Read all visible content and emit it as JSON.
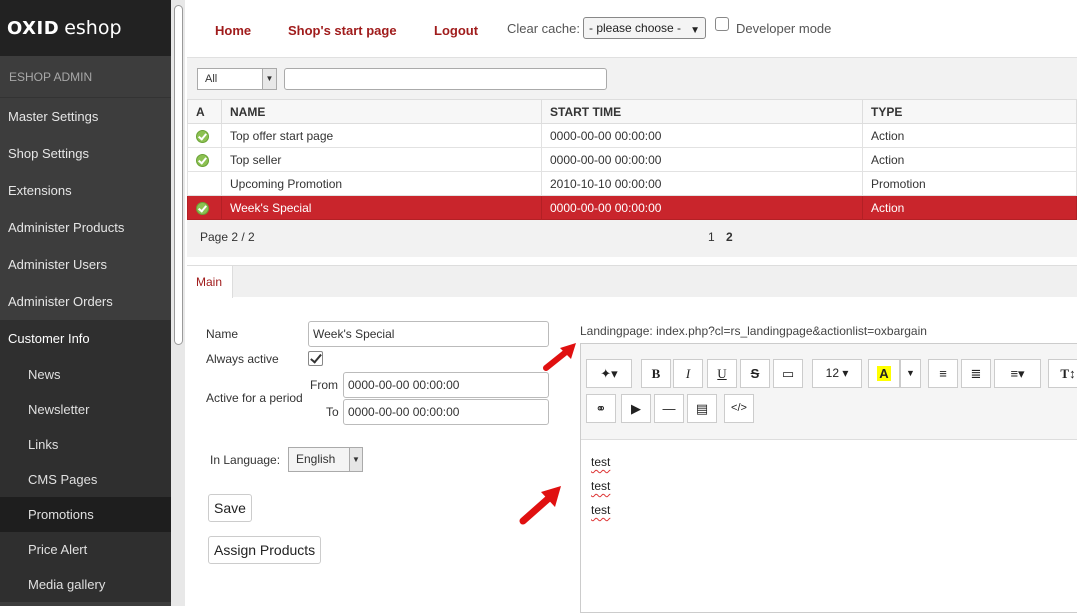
{
  "brand": {
    "logo_bold": "OXID",
    "logo_light": "eshop",
    "admin_label": "ESHOP ADMIN"
  },
  "sidebar": {
    "items": [
      {
        "label": "Master Settings"
      },
      {
        "label": "Shop Settings"
      },
      {
        "label": "Extensions"
      },
      {
        "label": "Administer Products"
      },
      {
        "label": "Administer Users"
      },
      {
        "label": "Administer Orders"
      },
      {
        "label": "Customer Info"
      }
    ],
    "subitems": [
      {
        "label": "News"
      },
      {
        "label": "Newsletter"
      },
      {
        "label": "Links"
      },
      {
        "label": "CMS Pages"
      },
      {
        "label": "Promotions"
      },
      {
        "label": "Price Alert"
      },
      {
        "label": "Media gallery"
      }
    ]
  },
  "topbar": {
    "home": "Home",
    "start_page": "Shop's start page",
    "logout": "Logout",
    "clear_cache_label": "Clear cache:",
    "clear_cache_value": "- please choose -",
    "developer_mode": "Developer mode"
  },
  "list": {
    "filter_value": "All",
    "search_value": "",
    "columns": [
      "A",
      "NAME",
      "START TIME",
      "TYPE"
    ],
    "rows": [
      {
        "active": true,
        "name": "Top offer start page",
        "start": "0000-00-00 00:00:00",
        "type": "Action"
      },
      {
        "active": true,
        "name": "Top seller",
        "start": "0000-00-00 00:00:00",
        "type": "Action"
      },
      {
        "active": false,
        "name": "Upcoming Promotion",
        "start": "2010-10-10 00:00:00",
        "type": "Promotion"
      },
      {
        "active": true,
        "name": "Week's Special",
        "start": "0000-00-00 00:00:00",
        "type": "Action",
        "selected": true
      }
    ],
    "page_info": "Page 2 / 2",
    "pages": [
      "1",
      "2"
    ],
    "current_page": "2"
  },
  "tabs": {
    "main": "Main"
  },
  "form": {
    "name_label": "Name",
    "name_value": "Week's Special",
    "always_active_label": "Always active",
    "always_active": true,
    "period_label": "Active for a period",
    "from_label": "From",
    "from_value": "0000-00-00 00:00:00",
    "to_label": "To",
    "to_value": "0000-00-00 00:00:00",
    "language_label": "In Language:",
    "language_value": "English",
    "save": "Save",
    "assign": "Assign Products"
  },
  "editor": {
    "landing": "Landingpage: index.php?cl=rs_landingpage&actionlist=oxbargain",
    "font_size": "12",
    "code_label": "</>",
    "lines": [
      "test",
      "test",
      "test"
    ]
  },
  "colors": {
    "accent": "#a01c1c",
    "selected_row": "#c9252c",
    "sidebar": "#3d3d3d"
  }
}
